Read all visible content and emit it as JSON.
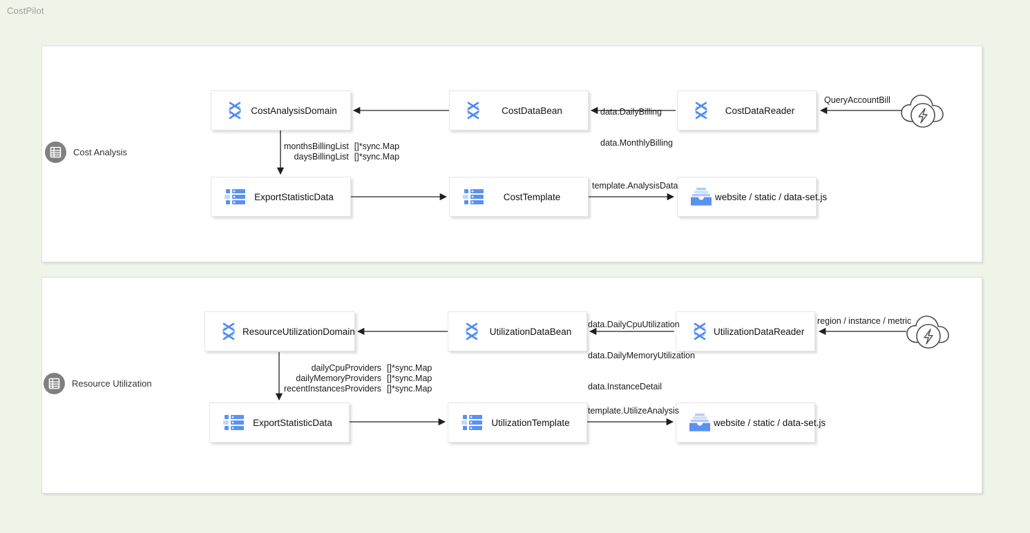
{
  "app": {
    "title": "CostPilot"
  },
  "groups": [
    {
      "id": "cost",
      "icon": "table-grid-icon",
      "label": "Cost Analysis"
    },
    {
      "id": "util",
      "icon": "table-grid-icon",
      "label": "Resource Utilization"
    }
  ],
  "nodes": {
    "cost_analysis_domain": {
      "label": "CostAnalysisDomain",
      "icon": "atom-icon"
    },
    "cost_data_bean": {
      "label": "CostDataBean",
      "icon": "atom-icon"
    },
    "cost_data_reader": {
      "label": "CostDataReader",
      "icon": "atom-icon"
    },
    "export_statistic_data_cost": {
      "label": "ExportStatisticData",
      "icon": "list-rows-icon"
    },
    "cost_template": {
      "label": "CostTemplate",
      "icon": "list-rows-icon"
    },
    "cost_output_file": {
      "label": "website / static / data-set.js",
      "icon": "tray-icon"
    },
    "resource_utilization_domain": {
      "label": "ResourceUtilizationDomain",
      "icon": "atom-icon"
    },
    "utilization_data_bean": {
      "label": "UtilizationDataBean",
      "icon": "atom-icon"
    },
    "utilization_data_reader": {
      "label": "UtilizationDataReader",
      "icon": "atom-icon"
    },
    "export_statistic_data_util": {
      "label": "ExportStatisticData",
      "icon": "list-rows-icon"
    },
    "utilization_template": {
      "label": "UtilizationTemplate",
      "icon": "list-rows-icon"
    },
    "util_output_file": {
      "label": "website / static / data-set.js",
      "icon": "tray-icon"
    }
  },
  "clouds": {
    "cost_cloud": {
      "icon": "cloud-bolt-icon"
    },
    "util_cloud": {
      "icon": "cloud-bolt-icon"
    }
  },
  "edge_labels": {
    "billing_data": {
      "line1": "data.DailyBilling",
      "line2": "data.MonthlyBilling"
    },
    "query_account_bill": {
      "text": "QueryAccountBill"
    },
    "months_billing": {
      "rows": [
        {
          "key": "monthsBillingList",
          "value": "[]*sync.Map"
        },
        {
          "key": "daysBillingList",
          "value": "[]*sync.Map"
        }
      ]
    },
    "template_analysis": {
      "text": "template.AnalysisData"
    },
    "utilization_data": {
      "line1": "data.DailyCpuUtilization",
      "line2": "data.DailyMemoryUtilization",
      "line3": "data.InstanceDetail"
    },
    "region_instance_metric": {
      "text": "region / instance / metric"
    },
    "providers": {
      "rows": [
        {
          "key": "dailyCpuProviders",
          "value": "[]*sync.Map"
        },
        {
          "key": "dailyMemoryProviders",
          "value": "[]*sync.Map"
        },
        {
          "key": "recentInstancesProviders",
          "value": "[]*sync.Map"
        }
      ]
    },
    "template_utilize": {
      "text": "template.UtilizeAnalysis"
    }
  },
  "colors": {
    "background": "#eff4e8",
    "group_fill": "#ffffff",
    "node_fill": "#ffffff",
    "icon_blue": "#5b91f0",
    "icon_blue_light": "#aecbf7",
    "badge_gray": "#808080",
    "title_gray": "#9aa09a",
    "edge_stroke": "#1f1f1f"
  }
}
